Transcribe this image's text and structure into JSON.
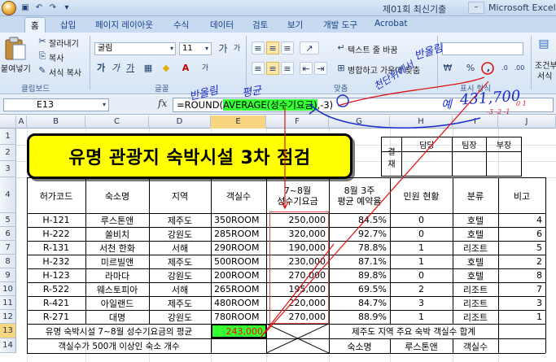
{
  "window": {
    "title": "제01회 최신기출",
    "app_name": "Microsoft Excel"
  },
  "ribbon": {
    "tabs": [
      "홈",
      "삽입",
      "페이지 레이아웃",
      "수식",
      "데이터",
      "검토",
      "보기",
      "개발 도구",
      "Acrobat"
    ],
    "active_tab": "홈",
    "clipboard": {
      "paste_label": "붙여넣기",
      "cut_label": "잘라내기",
      "copy_label": "복사",
      "format_painter_label": "서식 복사",
      "group_label": "클립보드"
    },
    "font": {
      "font_name": "굴림",
      "font_size": "11",
      "bold": "가",
      "italic": "가",
      "underline": "가",
      "increase_size": "가",
      "decrease_size": "가",
      "group_label": "글꼴"
    },
    "alignment": {
      "wrap_text_label": "텍스트 줄 바꿈",
      "merge_label": "병합하고 가운데 맞춤",
      "group_label": "맞춤"
    },
    "number": {
      "currency": "₩",
      "percent": "%",
      "comma": ",",
      "group_label": "표시 형식"
    },
    "styles": {
      "conditional_label_1": "조건부",
      "conditional_label_2": "서식"
    }
  },
  "formula_bar": {
    "name_box": "E13",
    "fx": "fx",
    "formula_prefix": "=ROUND(",
    "formula_highlight": "AVERAGE(성수기요금)",
    "formula_suffix": ",-3)"
  },
  "sheet": {
    "columns": [
      "A",
      "B",
      "C",
      "D",
      "E",
      "F",
      "G",
      "H",
      "I",
      "J"
    ],
    "rows": [
      "1",
      "2",
      "3",
      "4",
      "5",
      "6",
      "7",
      "8",
      "9",
      "10",
      "11",
      "12",
      "13",
      "14"
    ],
    "title": "유명 관광지 숙박시설 3차 점검",
    "approval": {
      "label": "결\n재",
      "headers": [
        "담당",
        "팀장",
        "부장"
      ]
    },
    "headers": [
      "허가코드",
      "숙소명",
      "지역",
      "객실수",
      "7~8월\n성수기요금",
      "8월 3주\n평균 예약율",
      "민원 현황",
      "분류",
      "비고"
    ],
    "data_rows": [
      [
        "H-121",
        "루스톤앤",
        "제주도",
        "350ROOM",
        "250,000",
        "84.5%",
        "0",
        "호텔",
        "4"
      ],
      [
        "H-222",
        "쏠비치",
        "강원도",
        "285ROOM",
        "320,000",
        "92.7%",
        "0",
        "호텔",
        "6"
      ],
      [
        "R-131",
        "서천 한화",
        "서해",
        "290ROOM",
        "190,000",
        "78.8%",
        "1",
        "리조트",
        "5"
      ],
      [
        "H-232",
        "미르빌앤",
        "제주도",
        "500ROOM",
        "230,000",
        "87.1%",
        "1",
        "호텔",
        "2"
      ],
      [
        "H-123",
        "라마다",
        "강원도",
        "200ROOM",
        "270,000",
        "89.8%",
        "0",
        "호텔",
        "8"
      ],
      [
        "R-522",
        "웨스토피아",
        "서해",
        "265ROOM",
        "195,000",
        "69.5%",
        "2",
        "리조트",
        "7"
      ],
      [
        "R-421",
        "아일랜드",
        "제주도",
        "480ROOM",
        "220,000",
        "84.7%",
        "3",
        "리조트",
        "3"
      ],
      [
        "R-271",
        "대명",
        "강원도",
        "780ROOM",
        "270,000",
        "88.9%",
        "1",
        "리조트",
        "1"
      ]
    ],
    "row13": {
      "label": "유명 숙박시설 7~8월 성수기요금의 평균",
      "value": "243,000",
      "right_label": "제주도 지역 주요 숙박 객실수 합계"
    },
    "row14": {
      "label": "객실수가 500개 이상인 숙소 개수",
      "name_label": "숙소명",
      "name_value": "루스톤앤",
      "room_label": "객실수"
    }
  },
  "annotations": {
    "note_round": "반올림",
    "note_average": "평균",
    "note_thousands": "천단위에서",
    "note_example": "예",
    "note_number": "431,700",
    "note_scale": "-3 -2 -1",
    "note_digits": "0 1",
    "note_format": "반올림"
  },
  "colors": {
    "banner_fill": "#ffff00",
    "highlight_green": "#33ff33",
    "annotation_blue": "#1a2ccc",
    "annotation_red": "#e01010"
  }
}
